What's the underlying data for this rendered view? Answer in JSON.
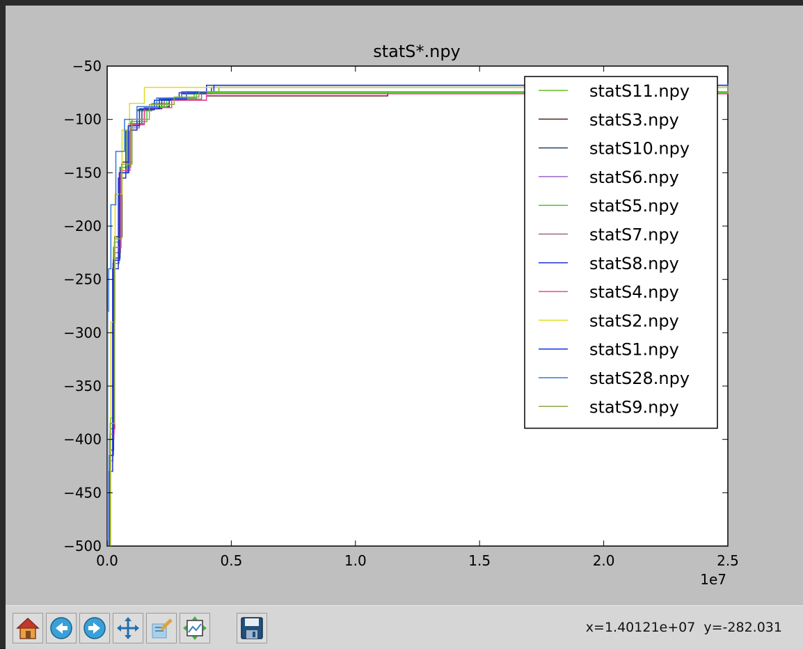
{
  "chart_data": {
    "type": "line",
    "title": "statS*.npy",
    "xlabel": "",
    "ylabel": "",
    "xlim": [
      0,
      25000000
    ],
    "ylim": [
      -500,
      -50
    ],
    "x_ticks": [
      0,
      5000000,
      10000000,
      15000000,
      20000000,
      25000000
    ],
    "x_tick_labels": [
      "0.0",
      "0.5",
      "1.0",
      "1.5",
      "2.0",
      "2.5"
    ],
    "x_offset_label": "1e7",
    "y_ticks": [
      -50,
      -100,
      -150,
      -200,
      -250,
      -300,
      -350,
      -400,
      -450,
      -500
    ],
    "y_tick_labels": [
      "−50",
      "−100",
      "−150",
      "−200",
      "−250",
      "−300",
      "−350",
      "−400",
      "−450",
      "−500"
    ],
    "grid": false,
    "legend_position": "top-right",
    "series": [
      {
        "name": "statS11.npy",
        "color": "#66bb22",
        "x": [
          0,
          100000,
          250000,
          500000,
          800000,
          1200000,
          1800000,
          2500000,
          3500000,
          4500000,
          25000000
        ],
        "y": [
          -500,
          -400,
          -220,
          -150,
          -110,
          -92,
          -85,
          -80,
          -75,
          -70,
          -68
        ]
      },
      {
        "name": "statS3.npy",
        "color": "#5a2a1e",
        "x": [
          0,
          120000,
          300000,
          600000,
          1000000,
          1500000,
          2500000,
          4000000,
          11300000,
          25000000
        ],
        "y": [
          -500,
          -390,
          -210,
          -140,
          -100,
          -88,
          -82,
          -78,
          -74,
          -70
        ]
      },
      {
        "name": "statS10.npy",
        "color": "#224466",
        "x": [
          0,
          110000,
          260000,
          520000,
          900000,
          1400000,
          2200000,
          3000000,
          4200000,
          25000000
        ],
        "y": [
          -500,
          -410,
          -230,
          -145,
          -105,
          -90,
          -82,
          -76,
          -70,
          -67
        ]
      },
      {
        "name": "statS6.npy",
        "color": "#9966cc",
        "x": [
          0,
          90000,
          230000,
          480000,
          850000,
          1300000,
          2000000,
          3000000,
          25000000
        ],
        "y": [
          -500,
          -420,
          -235,
          -150,
          -108,
          -90,
          -80,
          -74,
          -68
        ]
      },
      {
        "name": "statS5.npy",
        "color": "#44cc22",
        "x": [
          0,
          130000,
          290000,
          550000,
          950000,
          1600000,
          2400000,
          3600000,
          25000000
        ],
        "y": [
          -500,
          -380,
          -215,
          -145,
          -102,
          -88,
          -80,
          -75,
          -70
        ]
      },
      {
        "name": "statS7.npy",
        "color": "#996688",
        "x": [
          0,
          100000,
          270000,
          540000,
          880000,
          1500000,
          2300000,
          3800000,
          25000000
        ],
        "y": [
          -500,
          -400,
          -225,
          -150,
          -104,
          -89,
          -81,
          -74,
          -69
        ]
      },
      {
        "name": "statS8.npy",
        "color": "#2233cc",
        "x": [
          0,
          80000,
          220000,
          450000,
          750000,
          1200000,
          1900000,
          2900000,
          4000000,
          25000000
        ],
        "y": [
          -500,
          -430,
          -240,
          -155,
          -110,
          -91,
          -82,
          -75,
          -68,
          -66
        ]
      },
      {
        "name": "statS4.npy",
        "color": "#ee4499",
        "x": [
          0,
          110000,
          280000,
          560000,
          920000,
          1500000,
          2600000,
          4000000,
          25000000
        ],
        "y": [
          -500,
          -395,
          -220,
          -148,
          -105,
          -89,
          -82,
          -76,
          -70
        ]
      },
      {
        "name": "statS2.npy",
        "color": "#dddd22",
        "x": [
          0,
          150000,
          320000,
          600000,
          900000,
          1500000,
          25000000
        ],
        "y": [
          -500,
          -290,
          -170,
          -110,
          -85,
          -70,
          -66
        ]
      },
      {
        "name": "statS1.npy",
        "color": "#1133dd",
        "x": [
          0,
          90000,
          250000,
          500000,
          850000,
          1300000,
          2100000,
          3200000,
          4300000,
          25000000
        ],
        "y": [
          -500,
          -415,
          -232,
          -150,
          -106,
          -90,
          -81,
          -74,
          -68,
          -66
        ]
      },
      {
        "name": "statS28.npy",
        "color": "#3377dd",
        "x": [
          0,
          20000,
          60000,
          150000,
          350000,
          700000,
          1200000,
          2000000,
          3200000,
          25000000
        ],
        "y": [
          -500,
          -280,
          -240,
          -180,
          -130,
          -100,
          -88,
          -80,
          -74,
          -68
        ]
      },
      {
        "name": "statS9.npy",
        "color": "#88aa44",
        "x": [
          0,
          120000,
          300000,
          580000,
          1000000,
          1700000,
          2700000,
          3700000,
          25000000
        ],
        "y": [
          -500,
          -385,
          -212,
          -142,
          -100,
          -86,
          -79,
          -74,
          -69
        ]
      }
    ]
  },
  "toolbar": {
    "buttons": [
      {
        "name": "home-icon"
      },
      {
        "name": "back-icon"
      },
      {
        "name": "forward-icon"
      },
      {
        "name": "pan-icon"
      },
      {
        "name": "zoom-icon"
      },
      {
        "name": "subplots-icon"
      },
      {
        "name": "save-icon"
      }
    ],
    "coords": "x=1.40121e+07  y=-282.031"
  }
}
